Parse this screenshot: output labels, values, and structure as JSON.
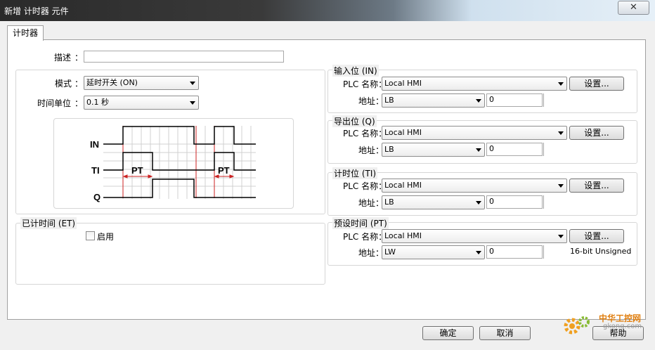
{
  "window": {
    "title": "新增 计时器 元件",
    "close_glyph": "✕"
  },
  "tabs": [
    {
      "label": "计时器"
    }
  ],
  "description": {
    "label": "描述",
    "colon": "：",
    "value": ""
  },
  "mode": {
    "label": "模式",
    "colon": "：",
    "value": "延时开关 (ON)"
  },
  "time_unit": {
    "label": "时间单位",
    "colon": "：",
    "value": "0.1 秒"
  },
  "diagram": {
    "labels": {
      "in": "IN",
      "ti": "TI",
      "q": "Q"
    },
    "pt": "PT"
  },
  "elapsed": {
    "title": "已计时间 (ET)",
    "enable_label": "启用",
    "enabled": false
  },
  "input_bit": {
    "title": "输入位 (IN)",
    "plc_label": "PLC 名称：",
    "plc_value": "Local HMI",
    "settings": "设置...",
    "addr_label": "地址：",
    "addr_type": "LB",
    "addr_value": "0",
    "addr_extra": ""
  },
  "output_bit": {
    "title": "导出位 (Q)",
    "plc_label": "PLC 名称：",
    "plc_value": "Local HMI",
    "settings": "设置...",
    "addr_label": "地址：",
    "addr_type": "LB",
    "addr_value": "0",
    "addr_extra": ""
  },
  "timing_bit": {
    "title": "计时位 (TI)",
    "plc_label": "PLC 名称：",
    "plc_value": "Local HMI",
    "settings": "设置...",
    "addr_label": "地址：",
    "addr_type": "LB",
    "addr_value": "0",
    "addr_extra": ""
  },
  "preset_time": {
    "title": "预设时间 (PT)",
    "plc_label": "PLC 名称：",
    "plc_value": "Local HMI",
    "settings": "设置...",
    "addr_label": "地址：",
    "addr_type": "LW",
    "addr_value": "0",
    "addr_extra": "16-bit Unsigned"
  },
  "footer": {
    "ok": "确定",
    "cancel": "取消",
    "help": "帮助"
  },
  "watermark": {
    "line1": "中华工控网",
    "line2": "gkong.com"
  }
}
